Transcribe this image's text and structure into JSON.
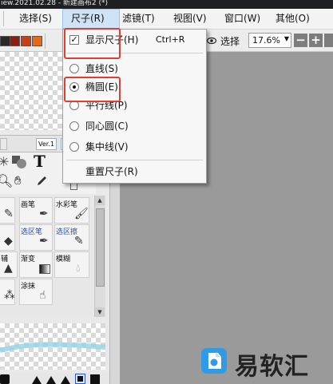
{
  "title_bar": {
    "text": "iew.2021.02.28 - 新建画布2 (*)"
  },
  "menubar": {
    "items": [
      {
        "label": "选择(S)"
      },
      {
        "label": "尺子(R)"
      },
      {
        "label": "滤镜(T)"
      },
      {
        "label": "视图(V)"
      },
      {
        "label": "窗口(W)"
      },
      {
        "label": "其他(O)"
      }
    ]
  },
  "toolbar": {
    "selection_label": "选择",
    "zoom_value": "17.6%",
    "swatch_colors": [
      "#2a2a2a",
      "#8b1f16",
      "#c8401a",
      "#e46a18"
    ]
  },
  "ruler_menu": {
    "show_ruler": {
      "label": "显示尺子(H)",
      "shortcut": "Ctrl+R",
      "checked": true
    },
    "types": [
      {
        "label": "直线(S)",
        "selected": false
      },
      {
        "label": "椭圆(E)",
        "selected": true
      },
      {
        "label": "平行线(P)",
        "selected": false
      },
      {
        "label": "同心圆(C)",
        "selected": false
      },
      {
        "label": "集中线(V)",
        "selected": false
      }
    ],
    "reset": {
      "label": "重置尺子(R)"
    }
  },
  "left_panel": {
    "tabs": [
      "Ver.1",
      "画具"
    ],
    "tools": [
      {
        "label": "画笔",
        "color": "black"
      },
      {
        "label": "水彩笔",
        "color": "black"
      },
      {
        "label": "选区笔",
        "color": "blue"
      },
      {
        "label": "选区擦",
        "color": "blue"
      },
      {
        "label": "渐变",
        "color": "black"
      },
      {
        "label": "模糊",
        "color": "black"
      },
      {
        "label": "涂抹",
        "color": "black"
      }
    ],
    "left_fragments": [
      "辅"
    ]
  },
  "watermark": {
    "text": "易软汇"
  }
}
